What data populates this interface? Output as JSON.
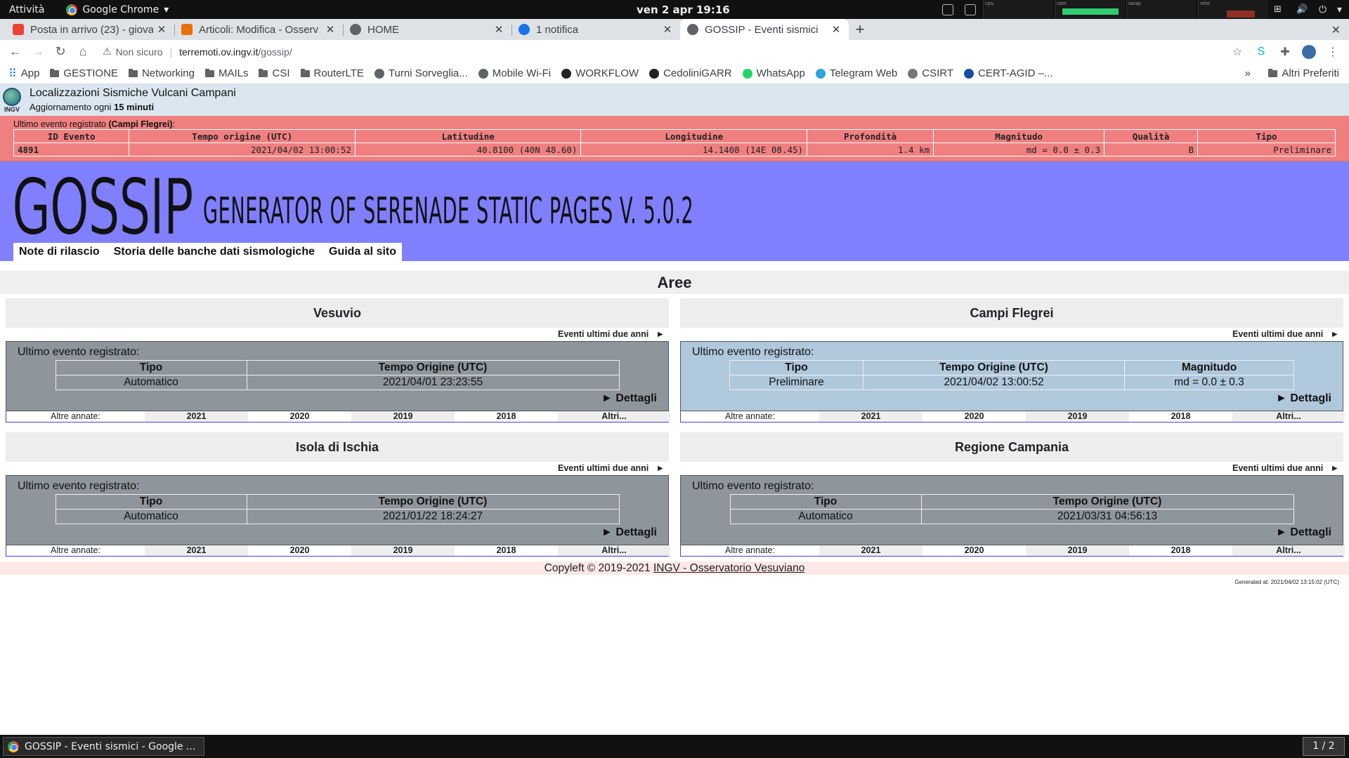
{
  "os": {
    "activities": "Attività",
    "app_name": "Google Chrome",
    "clock": "ven 2 apr  19:16",
    "graphs": [
      "cpu",
      "ram",
      "swap",
      "rete"
    ]
  },
  "tabs": [
    {
      "title": "Posta in arrivo (23) - giova",
      "color": "#ea4335"
    },
    {
      "title": "Articoli: Modifica - Osserv",
      "color": "#e8710a"
    },
    {
      "title": "HOME",
      "color": "#5f6368"
    },
    {
      "title": "1 notifica",
      "color": "#1a73e8"
    },
    {
      "title": "GOSSIP - Eventi sismici",
      "color": "#5f6368",
      "active": true
    }
  ],
  "omnibox": {
    "security": "Non sicuro",
    "url_host": "terremoti.ov.ingv.it",
    "url_path": "/gossip/"
  },
  "bookmarks": [
    {
      "label": "App",
      "kind": "apps"
    },
    {
      "label": "GESTIONE",
      "kind": "folder"
    },
    {
      "label": "Networking",
      "kind": "folder"
    },
    {
      "label": "MAILs",
      "kind": "folder"
    },
    {
      "label": "CSI",
      "kind": "folder"
    },
    {
      "label": "RouterLTE",
      "kind": "folder"
    },
    {
      "label": "Turni Sorveglia...",
      "kind": "site"
    },
    {
      "label": "Mobile Wi-Fi",
      "kind": "site"
    },
    {
      "label": "WORKFLOW",
      "kind": "site"
    },
    {
      "label": "CedoliniGARR",
      "kind": "site"
    },
    {
      "label": "WhatsApp",
      "kind": "site"
    },
    {
      "label": "Telegram Web",
      "kind": "site"
    },
    {
      "label": "CSIRT",
      "kind": "site"
    },
    {
      "label": "CERT-AGID –...",
      "kind": "site"
    }
  ],
  "bookmarks_more": "»",
  "bookmarks_other": "Altri Preferiti",
  "site": {
    "logo_text": "INGV",
    "title": "Localizzazioni Sismiche Vulcani Campani",
    "update_prefix": "Aggiornamento ogni ",
    "update_value": "15 minuti"
  },
  "last_event": {
    "caption_prefix": "Ultimo evento registrato ",
    "caption_area": "(Campi Flegrei)",
    "caption_suffix": ":",
    "headers": [
      "ID Evento",
      "Tempo origine (UTC)",
      "Latitudine",
      "Longitudine",
      "Profondità",
      "Magnitudo",
      "Qualità",
      "Tipo"
    ],
    "row": [
      "4891",
      "2021/04/02 13:00:52",
      "40.8100 (40N 48.60)",
      "14.1408 (14E 08.45)",
      "1.4 km",
      "md = 0.0 ± 0.3",
      "B",
      "Preliminare"
    ]
  },
  "banner": {
    "logo": "GOSSIP",
    "subtitle": "Generator Of Serenade Static Pages v. 5.0.2"
  },
  "nav": [
    "Note di rilascio",
    "Storia delle banche dati sismologiche",
    "Guida al sito"
  ],
  "aree_title": "Aree",
  "areas": [
    {
      "name": "Vesuvio",
      "link": "Eventi ultimi due anni",
      "arrow": "►",
      "last_label": "Ultimo evento registrato:",
      "headers": [
        "Tipo",
        "Tempo Origine (UTC)"
      ],
      "values": [
        "Automatico",
        "2021/04/01 23:23:55"
      ],
      "details": "► Dettagli",
      "style": "grey"
    },
    {
      "name": "Campi Flegrei",
      "link": "Eventi ultimi due anni",
      "arrow": "►",
      "last_label": "Ultimo evento registrato:",
      "headers": [
        "Tipo",
        "Tempo Origine (UTC)",
        "Magnitudo"
      ],
      "values": [
        "Preliminare",
        "2021/04/02 13:00:52",
        "md = 0.0 ± 0.3"
      ],
      "details": "► Dettagli",
      "style": "blue"
    },
    {
      "name": "Isola di Ischia",
      "link": "Eventi ultimi due anni",
      "arrow": "►",
      "last_label": "Ultimo evento registrato:",
      "headers": [
        "Tipo",
        "Tempo Origine (UTC)"
      ],
      "values": [
        "Automatico",
        "2021/01/22 18:24:27"
      ],
      "details": "► Dettagli",
      "style": "grey"
    },
    {
      "name": "Regione Campania",
      "link": "Eventi ultimi due anni",
      "arrow": "►",
      "last_label": "Ultimo evento registrato:",
      "headers": [
        "Tipo",
        "Tempo Origine (UTC)"
      ],
      "values": [
        "Automatico",
        "2021/03/31 04:56:13"
      ],
      "details": "► Dettagli",
      "style": "grey"
    }
  ],
  "years_label": "Altre annate:",
  "years": [
    "2021",
    "2020",
    "2019",
    "2018",
    "Altri..."
  ],
  "footer": {
    "prefix": "Copyleft © 2019-2021 ",
    "link": "INGV - Osservatorio Vesuviano"
  },
  "generated": "Generated at: 2021/04/02 13:15:02 (UTC)",
  "taskbar": {
    "window": "GOSSIP - Eventi sismici - Google ...",
    "pager": "1 / 2"
  }
}
